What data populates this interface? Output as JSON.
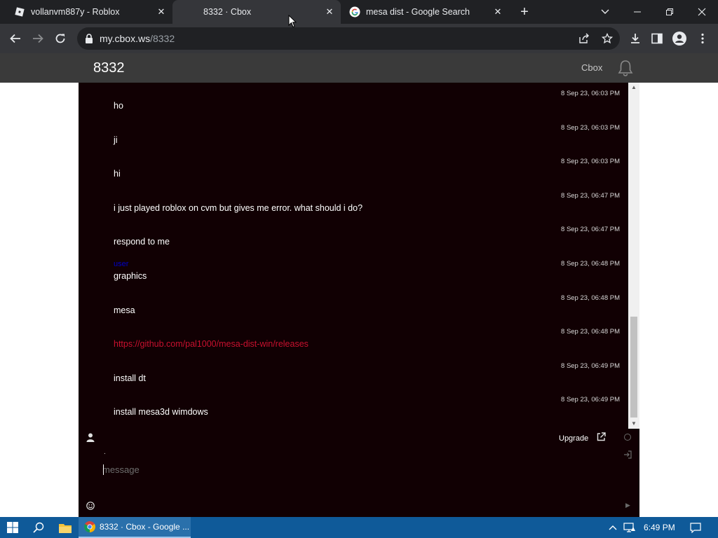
{
  "browser": {
    "tabs": [
      {
        "title": "vollanvm887y - Roblox",
        "icon": "roblox-icon",
        "active": false
      },
      {
        "title": "8332 · Cbox",
        "icon": "blank-page-icon",
        "active": true
      },
      {
        "title": "mesa dist - Google Search",
        "icon": "google-icon",
        "active": false
      }
    ],
    "url_host": "my.cbox.ws",
    "url_path": "/8332"
  },
  "cbox": {
    "title": "8332",
    "brand": "Cbox",
    "messages": [
      {
        "timestamp": "8 Sep 23, 06:03 PM",
        "name": "",
        "text": "ho",
        "is_link": false
      },
      {
        "timestamp": "8 Sep 23, 06:03 PM",
        "name": "",
        "text": "ji",
        "is_link": false
      },
      {
        "timestamp": "8 Sep 23, 06:03 PM",
        "name": "",
        "text": "hi",
        "is_link": false
      },
      {
        "timestamp": "8 Sep 23, 06:47 PM",
        "name": "",
        "text": "i just played roblox on cvm but gives me error. what should i do?",
        "is_link": false
      },
      {
        "timestamp": "8 Sep 23, 06:47 PM",
        "name": "",
        "text": "respond to me",
        "is_link": false
      },
      {
        "timestamp": "8 Sep 23, 06:48 PM",
        "name": "user",
        "text": "graphics",
        "is_link": false
      },
      {
        "timestamp": "8 Sep 23, 06:48 PM",
        "name": "",
        "text": "mesa",
        "is_link": false
      },
      {
        "timestamp": "8 Sep 23, 06:48 PM",
        "name": "",
        "text": "https://github.com/pal1000/mesa-dist-win/releases",
        "is_link": true
      },
      {
        "timestamp": "8 Sep 23, 06:49 PM",
        "name": "",
        "text": "install dt",
        "is_link": false
      },
      {
        "timestamp": "8 Sep 23, 06:49 PM",
        "name": "",
        "text": "install mesa3d wimdows",
        "is_link": false
      }
    ],
    "upgrade_label": "Upgrade",
    "name_field": ".",
    "message_placeholder": "message",
    "message_value": ""
  },
  "taskbar": {
    "app_label": "8332 · Cbox - Google ...",
    "clock": "6:49 PM"
  },
  "colors": {
    "chat_bg": "#110003",
    "link": "#c8102e",
    "taskbar": "#0f5a99"
  }
}
